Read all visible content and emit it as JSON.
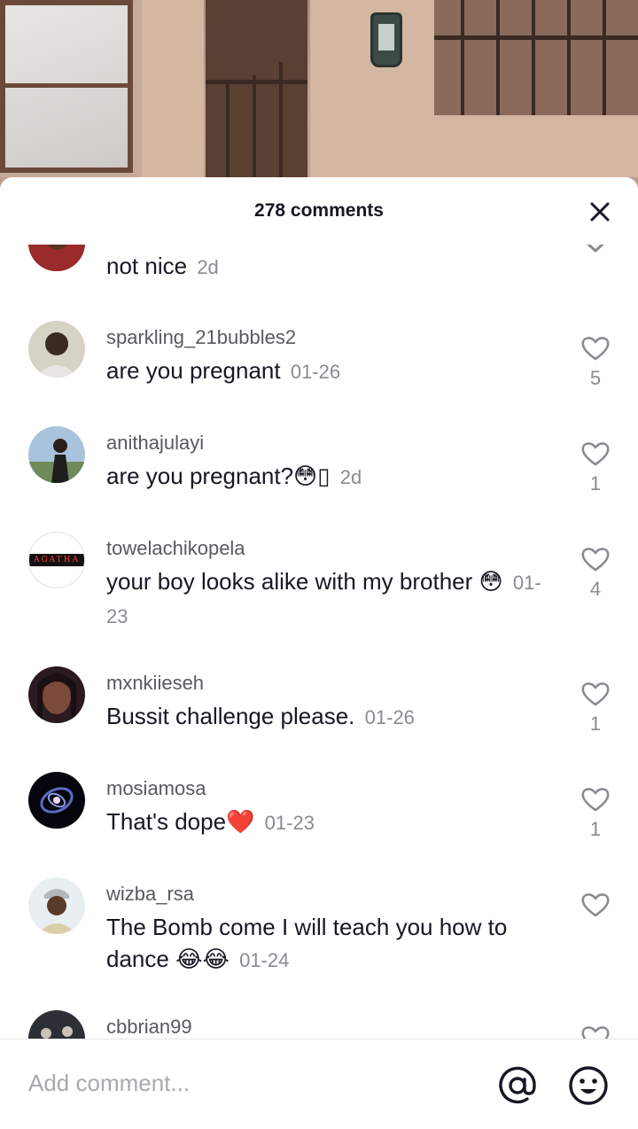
{
  "sheet": {
    "title": "278 comments"
  },
  "comments": [
    {
      "username": "",
      "text": "not nice",
      "time": "2d",
      "likes": ""
    },
    {
      "username": "sparkling_21bubbles2",
      "text": "are you pregnant",
      "time": "01-26",
      "likes": "5"
    },
    {
      "username": "anithajulayi",
      "text": "are you pregnant?😳▯",
      "time": "2d",
      "likes": "1"
    },
    {
      "username": "towelachikopela",
      "text": "your boy looks alike with my brother 😳",
      "time": "01-23",
      "likes": "4",
      "avatar_text": "AGATHA"
    },
    {
      "username": "mxnkiieseh",
      "text": "Bussit challenge please.",
      "time": "01-26",
      "likes": "1"
    },
    {
      "username": "mosiamosa",
      "text": "That's dope❤️",
      "time": "01-23",
      "likes": "1"
    },
    {
      "username": "wizba_rsa",
      "text": "The Bomb come I will teach you how to dance 😂😂",
      "time": "01-24",
      "likes": ""
    },
    {
      "username": "cbbrian99",
      "text": "",
      "time": "",
      "likes": ""
    }
  ],
  "footer": {
    "placeholder": "Add comment..."
  },
  "colors": {
    "text": "#161823",
    "secondary": "#8a8b91",
    "heart": "#8a8b91",
    "emoji_red": "#d0021b"
  },
  "icons": [
    "close-icon",
    "heart-icon",
    "chevron-down-icon",
    "at-sign-icon",
    "emoji-icon"
  ]
}
